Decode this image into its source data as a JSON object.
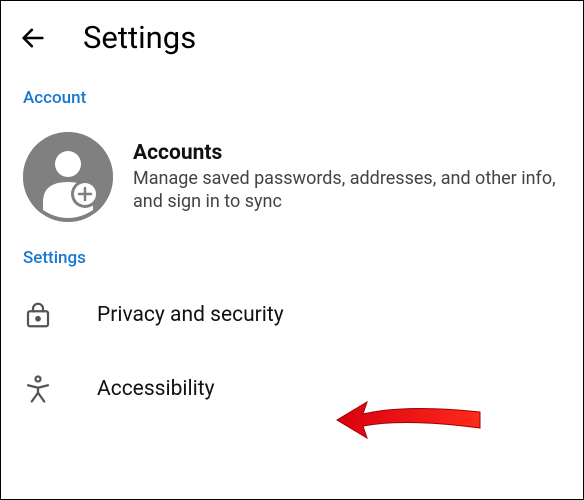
{
  "header": {
    "title": "Settings"
  },
  "sections": {
    "account": {
      "header": "Account",
      "accounts_item": {
        "title": "Accounts",
        "description": "Manage saved passwords, addresses, and other info, and sign in to sync"
      }
    },
    "settings": {
      "header": "Settings",
      "items": [
        {
          "label": "Privacy and security",
          "icon": "lock-icon"
        },
        {
          "label": "Accessibility",
          "icon": "accessibility-icon"
        }
      ]
    }
  }
}
